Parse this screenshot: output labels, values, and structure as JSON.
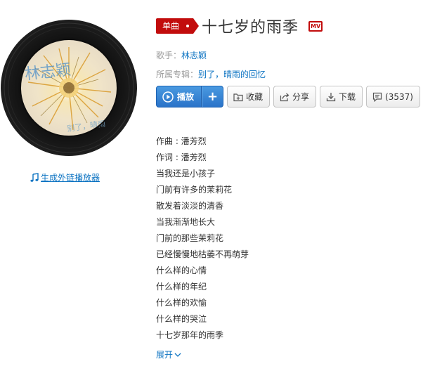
{
  "cover": {
    "art_text": "林志颖",
    "art_subtext": "别了，晴雨"
  },
  "ext_player_link": "生成外链播放器",
  "song": {
    "badge": "单曲",
    "title": "十七岁的雨季",
    "mv_label": "MV"
  },
  "meta": {
    "singer_label": "歌手：",
    "singer": "林志颖",
    "album_label": "所属专辑：",
    "album": "别了，晴雨的回忆"
  },
  "actions": {
    "play": "播放",
    "add": "+",
    "collect": "收藏",
    "share": "分享",
    "download": "下载",
    "comments": "(3537)"
  },
  "lyrics": [
    "作曲 : 潘芳烈",
    "作词 : 潘芳烈",
    "当我还是小孩子",
    "门前有许多的茉莉花",
    "散发着淡淡的清香",
    "当我渐渐地长大",
    "门前的那些茉莉花",
    "已经慢慢地枯萎不再萌芽",
    "什么样的心情",
    "什么样的年纪",
    "什么样的欢愉",
    "什么样的哭泣",
    "十七岁那年的雨季"
  ],
  "expand_label": "展开",
  "colors": {
    "accent_red": "#c20c0c",
    "link_blue": "#0c73c2",
    "play_blue": "#2a73c9"
  }
}
